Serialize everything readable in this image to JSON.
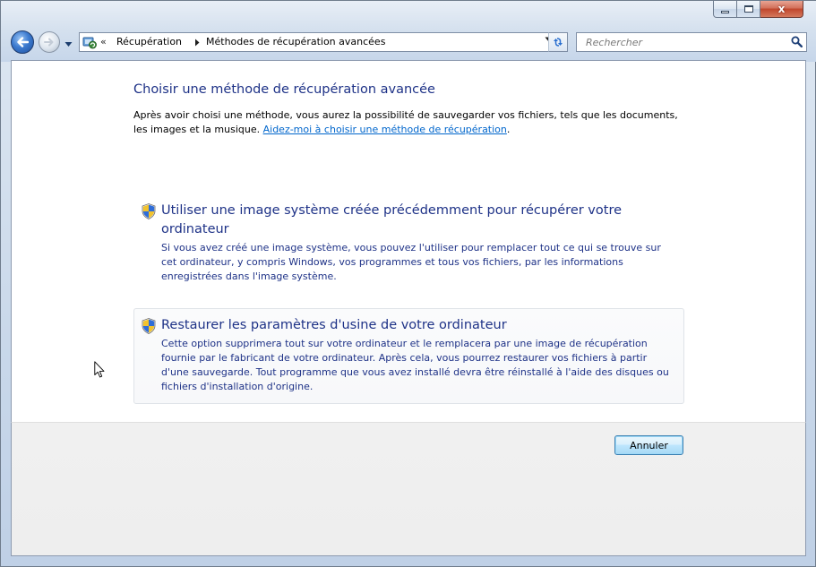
{
  "window": {
    "caption_buttons": [
      "minimize",
      "maximize",
      "close"
    ],
    "close_glyph": "x"
  },
  "nav": {
    "address_prefix": "«",
    "breadcrumbs": [
      "Récupération",
      "Méthodes de récupération avancées"
    ],
    "search_placeholder": "Rechercher"
  },
  "content": {
    "heading": "Choisir une méthode de récupération avancée",
    "intro_text": "Après avoir choisi une méthode, vous aurez la possibilité de sauvegarder vos fichiers, tels que les documents, les images et la musique.",
    "help_link": "Aidez-moi à choisir une méthode de récupération",
    "help_link_suffix": ".",
    "options": [
      {
        "title": "Utiliser une image système créée précédemment pour récupérer votre ordinateur",
        "description": "Si vous avez créé une image système, vous pouvez l'utiliser pour remplacer tout ce qui se trouve sur cet ordinateur, y compris Windows, vos programmes et tous vos fichiers, par les informations enregistrées dans l'image système."
      },
      {
        "title": "Restaurer les paramètres d'usine de votre ordinateur",
        "description": "Cette option supprimera tout sur votre ordinateur et le remplacera par une image de récupération fournie par le fabricant de votre ordinateur. Après cela, vous pourrez restaurer vos fichiers à partir d'une sauvegarde. Tout programme que vous avez installé devra être réinstallé à l'aide des disques ou fichiers d'installation d'origine."
      }
    ]
  },
  "footer": {
    "cancel_label": "Annuler"
  },
  "icons": {
    "back": "back-arrow-icon",
    "forward": "forward-arrow-icon",
    "address": "recovery-icon",
    "refresh": "refresh-icon",
    "search": "magnifier-icon",
    "option": "uac-shield-icon",
    "cursor": "mouse-pointer-icon"
  },
  "colors": {
    "heading": "#1e3287",
    "link": "#0066cc",
    "close_button": "#c0462c",
    "button_accent": "#3c7fb1"
  }
}
